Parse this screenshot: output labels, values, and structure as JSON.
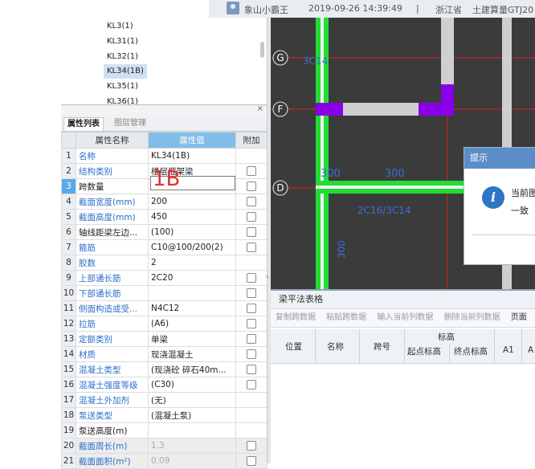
{
  "topbar": {
    "user": "象山小霸王",
    "timestamp": "2019-09-26 14:39:49",
    "sep": "|",
    "region": "浙江省",
    "product": "土建算量GTJ20"
  },
  "tree": {
    "items": [
      "KL3(1)",
      "KL31(1)",
      "KL32(1)",
      "KL34(1B)",
      "KL35(1)",
      "KL36(1)"
    ],
    "selected": "KL34(1B)"
  },
  "panel": {
    "close": "×",
    "tabs": [
      "属性列表",
      "图层管理"
    ],
    "columns": {
      "name": "属性名称",
      "value": "属性值",
      "extra": "附加"
    },
    "rows": [
      {
        "n": "1",
        "name": "名称",
        "value": "KL34(1B)",
        "check": false,
        "blue": true
      },
      {
        "n": "2",
        "name": "结构类别",
        "value": "楼层框架梁",
        "check": true,
        "blue": true
      },
      {
        "n": "3",
        "name": "跨数量",
        "value": "",
        "check": true,
        "blue": false,
        "active": true
      },
      {
        "n": "4",
        "name": "截面宽度(mm)",
        "value": "200",
        "check": true,
        "blue": true
      },
      {
        "n": "5",
        "name": "截面高度(mm)",
        "value": "450",
        "check": true,
        "blue": true
      },
      {
        "n": "6",
        "name": "轴线距梁左边...",
        "value": "(100)",
        "check": true,
        "blue": false
      },
      {
        "n": "7",
        "name": "箍筋",
        "value": "C10@100/200(2)",
        "check": true,
        "blue": true
      },
      {
        "n": "8",
        "name": "胶数",
        "value": "2",
        "check": false,
        "blue": true
      },
      {
        "n": "9",
        "name": "上部通长筋",
        "value": "2C20",
        "check": true,
        "blue": true
      },
      {
        "n": "10",
        "name": "下部通长筋",
        "value": "",
        "check": true,
        "blue": true
      },
      {
        "n": "11",
        "name": "侧面构造或受...",
        "value": "N4C12",
        "check": true,
        "blue": true
      },
      {
        "n": "12",
        "name": "拉筋",
        "value": "(A6)",
        "check": true,
        "blue": true
      },
      {
        "n": "13",
        "name": "定额类别",
        "value": "单梁",
        "check": true,
        "blue": true
      },
      {
        "n": "14",
        "name": "材质",
        "value": "现浇混凝土",
        "check": true,
        "blue": true
      },
      {
        "n": "15",
        "name": "混凝土类型",
        "value": "(现浇砼 碎石40m...",
        "check": true,
        "blue": true
      },
      {
        "n": "16",
        "name": "混凝土强度等级",
        "value": "(C30)",
        "check": true,
        "blue": true
      },
      {
        "n": "17",
        "name": "混凝土外加剂",
        "value": "(无)",
        "check": false,
        "blue": true
      },
      {
        "n": "18",
        "name": "泵送类型",
        "value": "(混凝土泵)",
        "check": false,
        "blue": true
      },
      {
        "n": "19",
        "name": "泵送高度(m)",
        "value": "",
        "check": false,
        "blue": false
      },
      {
        "n": "20",
        "name": "截面周长(m)",
        "value": "1.3",
        "check": true,
        "blue": true,
        "disabled": true
      },
      {
        "n": "21",
        "name": "截面面积(m²)",
        "value": "0.09",
        "check": true,
        "blue": true,
        "disabled": true
      }
    ]
  },
  "annotation": "1B",
  "cad": {
    "axes": {
      "g": "G",
      "f": "F",
      "d": "D"
    },
    "dims": {
      "a": "300",
      "b": "300",
      "c": "2C16/3C14",
      "d": "300",
      "e": "3C14"
    }
  },
  "dialog": {
    "title": "提示",
    "icon": "info-icon",
    "msg1": "当前图",
    "msg2": "一致"
  },
  "beam_table": {
    "title": "梁平法表格",
    "toolbar": [
      "复制跨数据",
      "粘贴跨数据",
      "输入当前列数据",
      "删除当前列数据",
      "页面"
    ],
    "headers": {
      "position": "位置",
      "name": "名称",
      "span": "跨号",
      "elevation": "标高",
      "start_elev": "起点标高",
      "end_elev": "终点标高",
      "a1": "A1",
      "a_next": "A"
    }
  },
  "colors": {
    "beam_green": "#22dd33",
    "support_purple": "#8a00e6",
    "axis_red": "#e02020",
    "cad_bg": "#3b3b3b"
  }
}
